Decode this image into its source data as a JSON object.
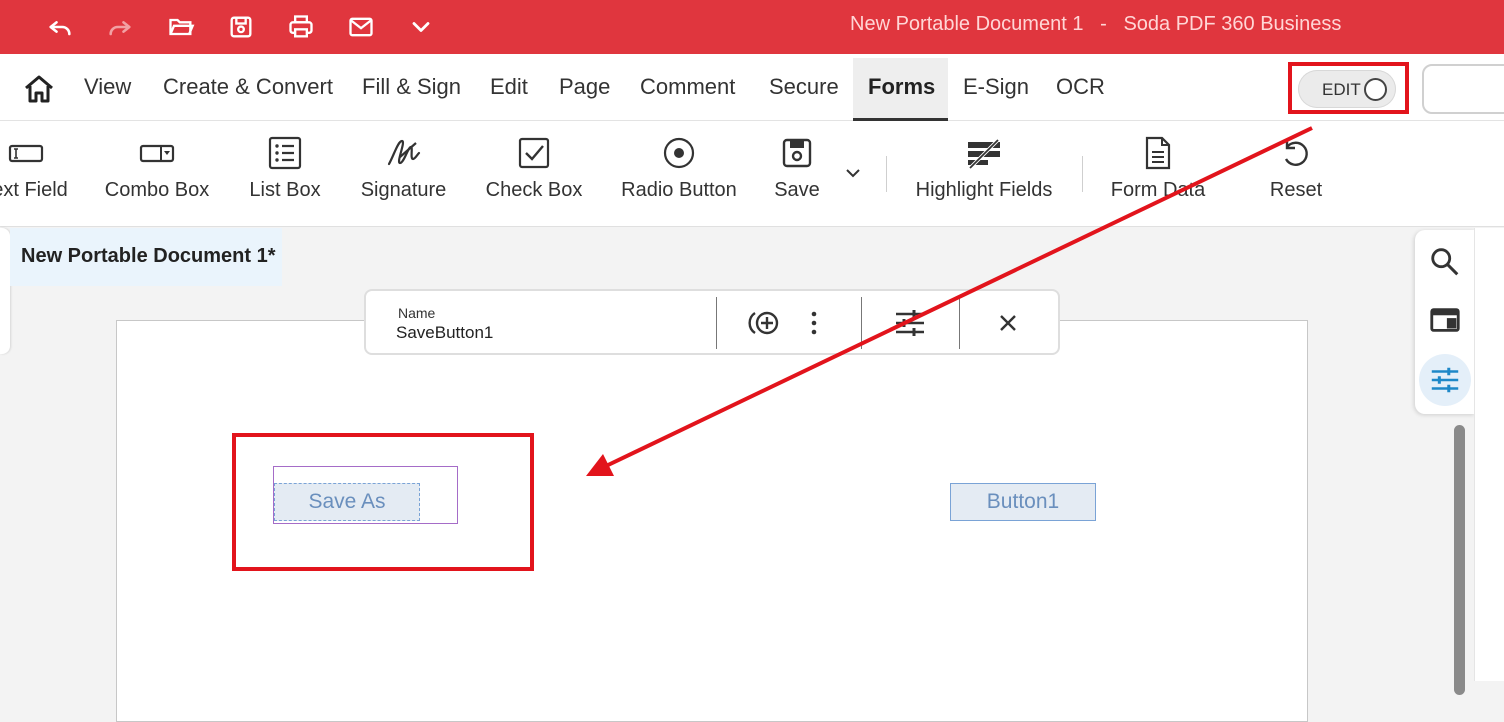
{
  "window": {
    "title": "New Portable Document 1   -   Soda PDF 360 Business"
  },
  "quick_access": [
    {
      "name": "undo-icon"
    },
    {
      "name": "redo-icon"
    },
    {
      "name": "open-folder-icon"
    },
    {
      "name": "save-icon"
    },
    {
      "name": "print-icon"
    },
    {
      "name": "mail-icon"
    },
    {
      "name": "chevron-down-icon"
    }
  ],
  "tabs": {
    "view": "View",
    "create": "Create & Convert",
    "fill": "Fill & Sign",
    "edit": "Edit",
    "page": "Page",
    "comment": "Comment",
    "secure": "Secure",
    "forms": "Forms",
    "esign": "E-Sign",
    "ocr": "OCR"
  },
  "edit_toggle": {
    "label": "EDIT"
  },
  "toolbar": {
    "text_field": "ext Field",
    "combo_box": "Combo Box",
    "list_box": "List Box",
    "signature": "Signature",
    "check_box": "Check Box",
    "radio_button": "Radio Button",
    "save": "Save",
    "highlight_fields": "Highlight Fields",
    "form_data": "Form Data",
    "reset": "Reset"
  },
  "document_tab": {
    "title": "New Portable Document 1*"
  },
  "properties_bar": {
    "name_label": "Name",
    "name_value": "SaveButton1"
  },
  "page_fields": {
    "save_as": "Save As",
    "button1": "Button1"
  },
  "colors": {
    "titlebar": "#e0363e",
    "annotation": "#e2141c",
    "field_border": "#7aa3d6"
  }
}
